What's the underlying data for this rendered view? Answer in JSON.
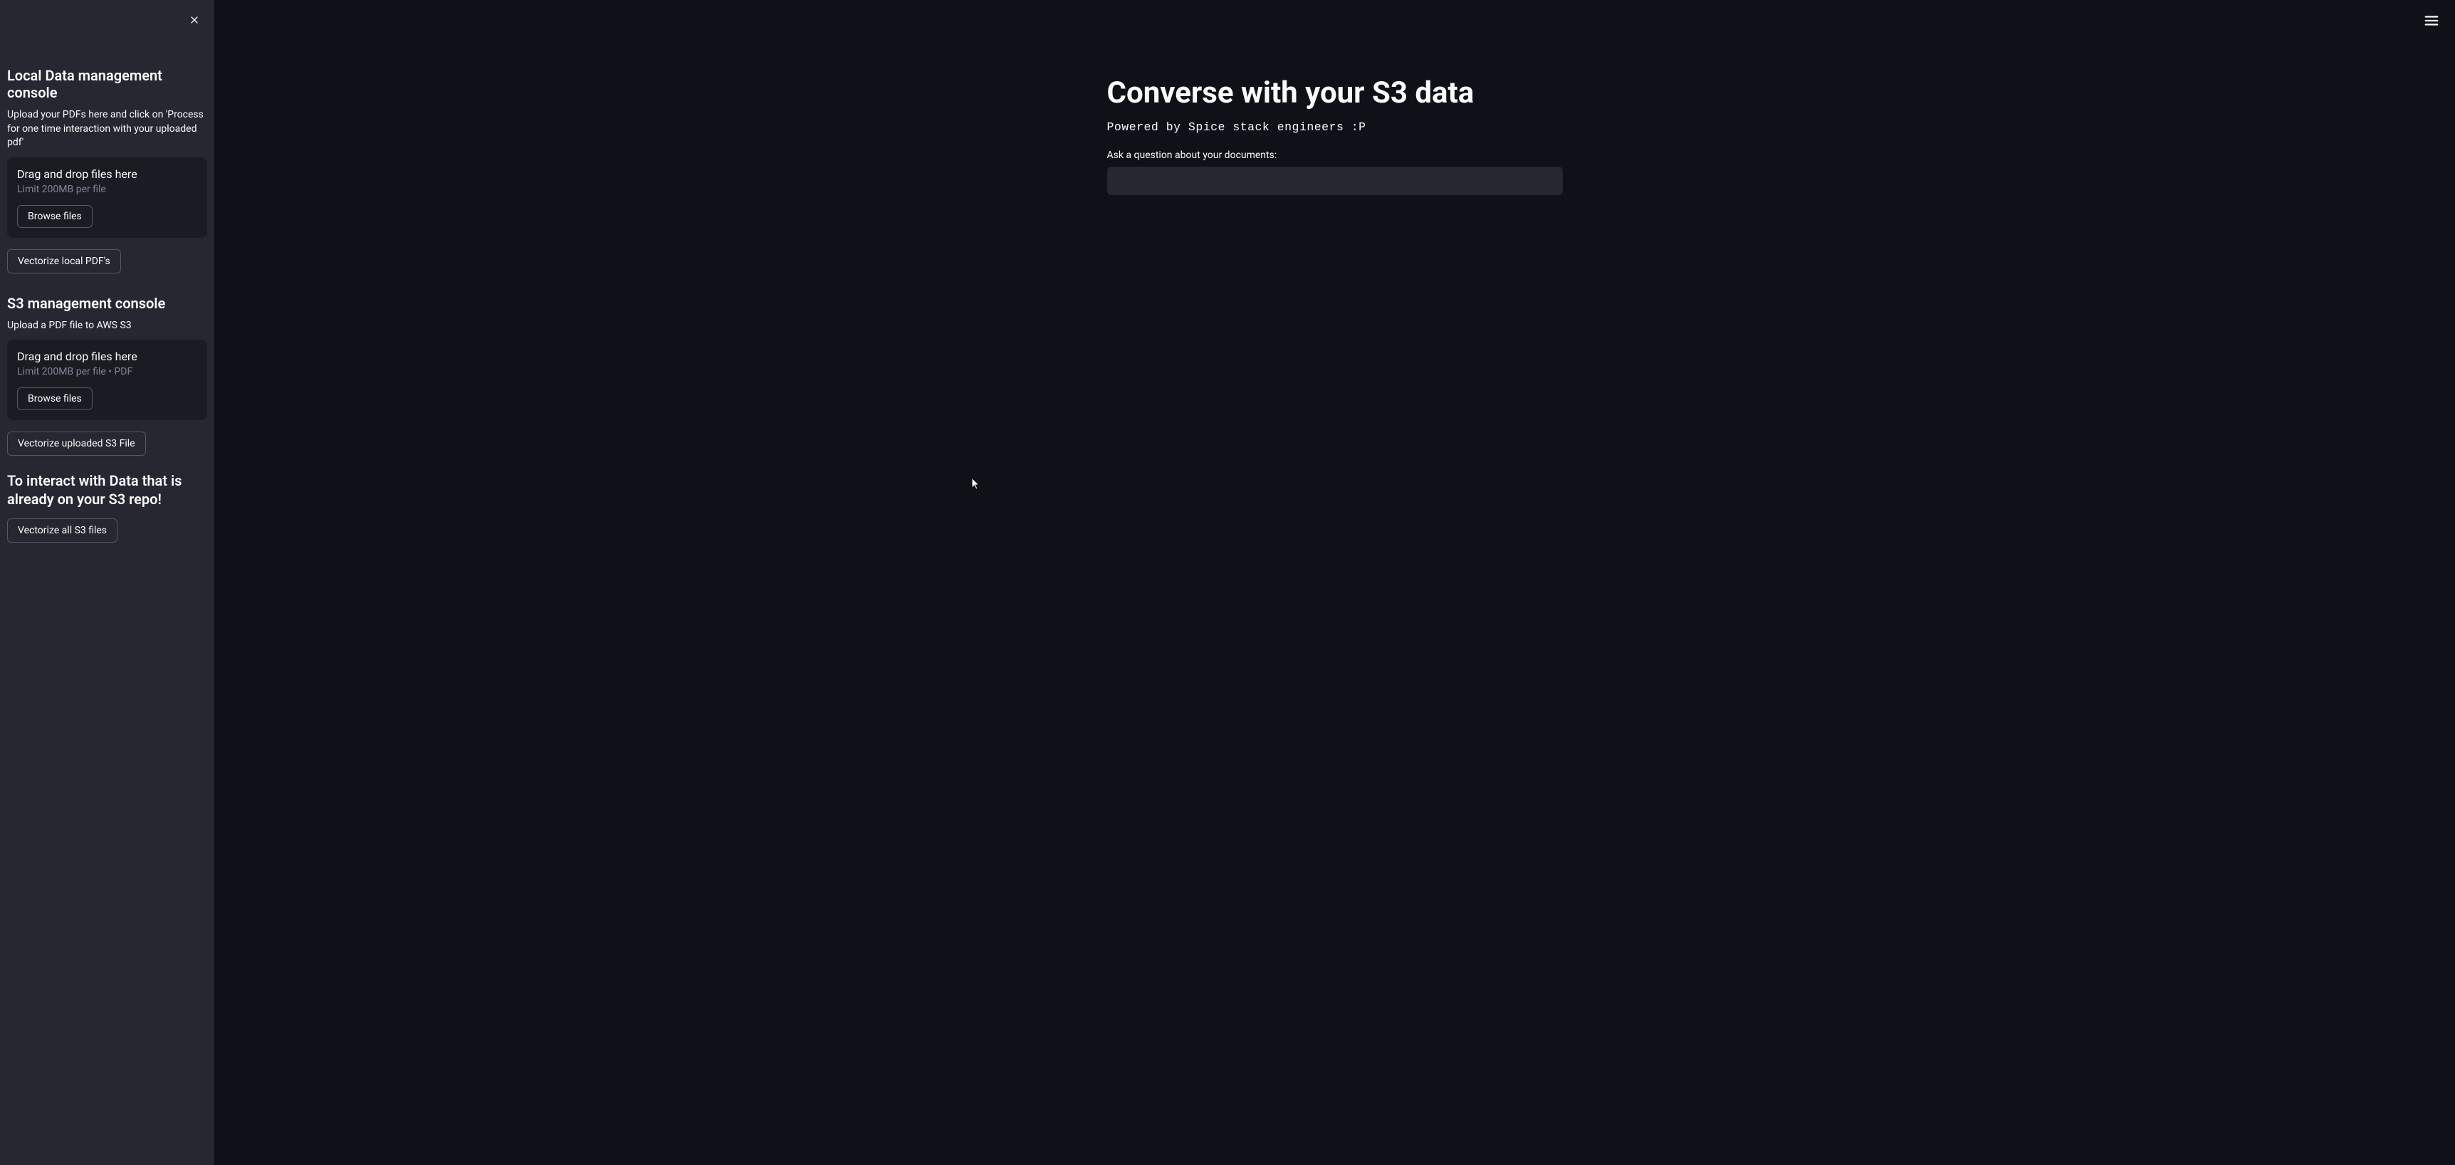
{
  "sidebar": {
    "local_section": {
      "header": "Local Data management console",
      "description": "Upload your PDFs here and click on 'Process for one time interaction with your uploaded pdf'",
      "upload_title": "Drag and drop files here",
      "upload_hint": "Limit 200MB per file",
      "browse_label": "Browse files",
      "vectorize_label": "Vectorize local PDF's"
    },
    "s3_section": {
      "header": "S3 management console",
      "description": "Upload a PDF file to AWS S3",
      "upload_title": "Drag and drop files here",
      "upload_hint": "Limit 200MB per file • PDF",
      "browse_label": "Browse files",
      "vectorize_uploaded_label": "Vectorize uploaded S3 File"
    },
    "interact_section": {
      "header": "To interact with Data that is already on your S3 repo!",
      "vectorize_all_label": "Vectorize all S3 files"
    }
  },
  "main": {
    "title": "Converse with your S3 data",
    "subtitle": "Powered by Spice stack engineers :P",
    "input_label": "Ask a question about your documents:",
    "input_value": ""
  }
}
